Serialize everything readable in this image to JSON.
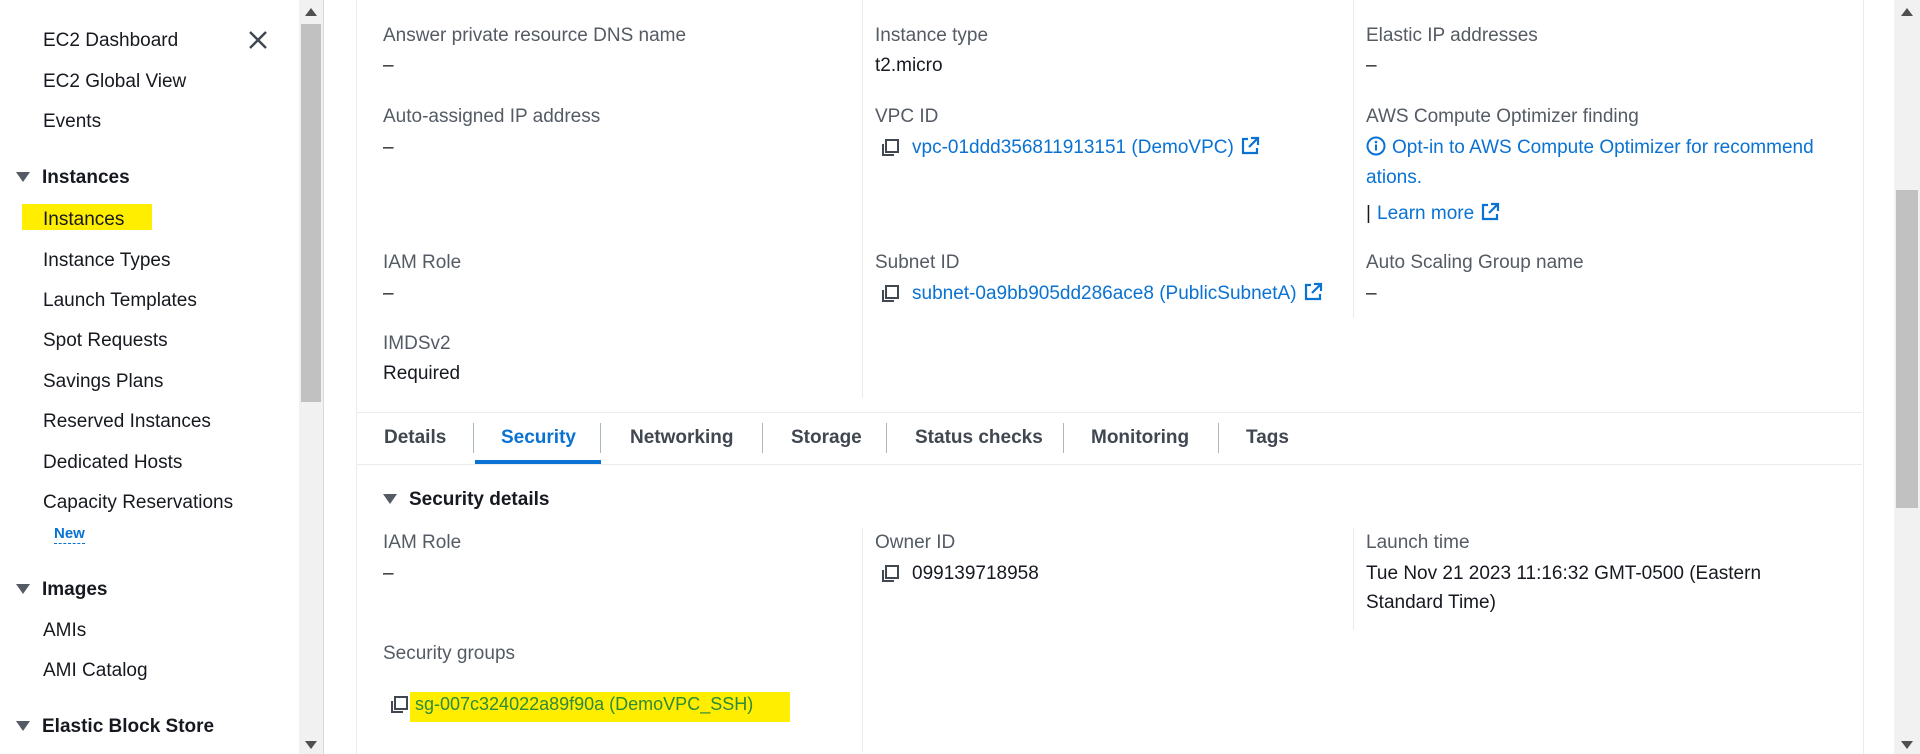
{
  "sidebar": {
    "items_top": [
      "EC2 Dashboard",
      "EC2 Global View",
      "Events"
    ],
    "sections": {
      "instances": "Instances",
      "images": "Images",
      "ebs": "Elastic Block Store"
    },
    "instances_items": [
      "Instances",
      "Instance Types",
      "Launch Templates",
      "Spot Requests",
      "Savings Plans",
      "Reserved Instances",
      "Dedicated Hosts",
      "Capacity Reservations"
    ],
    "new_badge": "New",
    "images_items": [
      "AMIs",
      "AMI Catalog"
    ]
  },
  "details": {
    "answer_dns": {
      "label": "Answer private resource DNS name",
      "value": "–"
    },
    "instance_type": {
      "label": "Instance type",
      "value": "t2.micro"
    },
    "elastic_ip": {
      "label": "Elastic IP addresses",
      "value": "–"
    },
    "auto_ip": {
      "label": "Auto-assigned IP address",
      "value": "–"
    },
    "vpc": {
      "label": "VPC ID",
      "value": "vpc-01ddd356811913151 (DemoVPC)"
    },
    "optimizer": {
      "label": "AWS Compute Optimizer finding",
      "line1": "Opt-in to AWS Compute Optimizer for recommend",
      "line2": "ations.",
      "learn_prefix": "|",
      "learn_more": "Learn more"
    },
    "iam_role": {
      "label": "IAM Role",
      "value": "–"
    },
    "subnet": {
      "label": "Subnet ID",
      "value": "subnet-0a9bb905dd286ace8 (PublicSubnetA)"
    },
    "asg": {
      "label": "Auto Scaling Group name",
      "value": "–"
    },
    "imdsv2": {
      "label": "IMDSv2",
      "value": "Required"
    }
  },
  "tabs": [
    "Details",
    "Security",
    "Networking",
    "Storage",
    "Status checks",
    "Monitoring",
    "Tags"
  ],
  "active_tab": "Security",
  "security": {
    "title": "Security details",
    "iam_role": {
      "label": "IAM Role",
      "value": "–"
    },
    "owner": {
      "label": "Owner ID",
      "value": "099139718958"
    },
    "launch": {
      "label": "Launch time",
      "line1": "Tue Nov 21 2023 11:16:32 GMT-0500 (Eastern",
      "line2": "Standard Time)"
    },
    "sg": {
      "label": "Security groups",
      "value": "sg-007c324022a89f90a (DemoVPC_SSH)"
    }
  },
  "colors": {
    "link": "#0972d3",
    "highlight": "#ffee00",
    "label": "#545b64"
  }
}
